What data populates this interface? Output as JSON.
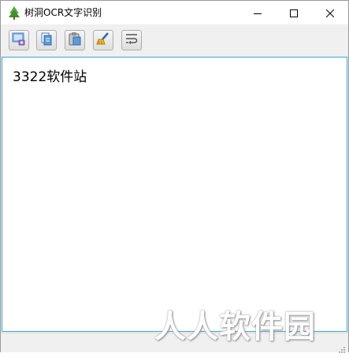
{
  "window": {
    "title": "树洞OCR文字识别",
    "icon": "tree-icon"
  },
  "titlebar": {
    "minimize_glyph": "—",
    "maximize_glyph": "☐",
    "close_glyph": "✕"
  },
  "toolbar": {
    "buttons": [
      {
        "icon": "screenshot-icon"
      },
      {
        "icon": "open-file-icon"
      },
      {
        "icon": "clipboard-icon"
      },
      {
        "icon": "clear-brush-icon"
      },
      {
        "icon": "wrap-text-icon"
      }
    ]
  },
  "editor": {
    "text": "3322软件站"
  },
  "watermark": {
    "text": "人人软件园"
  },
  "colors": {
    "accent": "#3aa7d8",
    "window_bg": "#f0f0f0"
  }
}
